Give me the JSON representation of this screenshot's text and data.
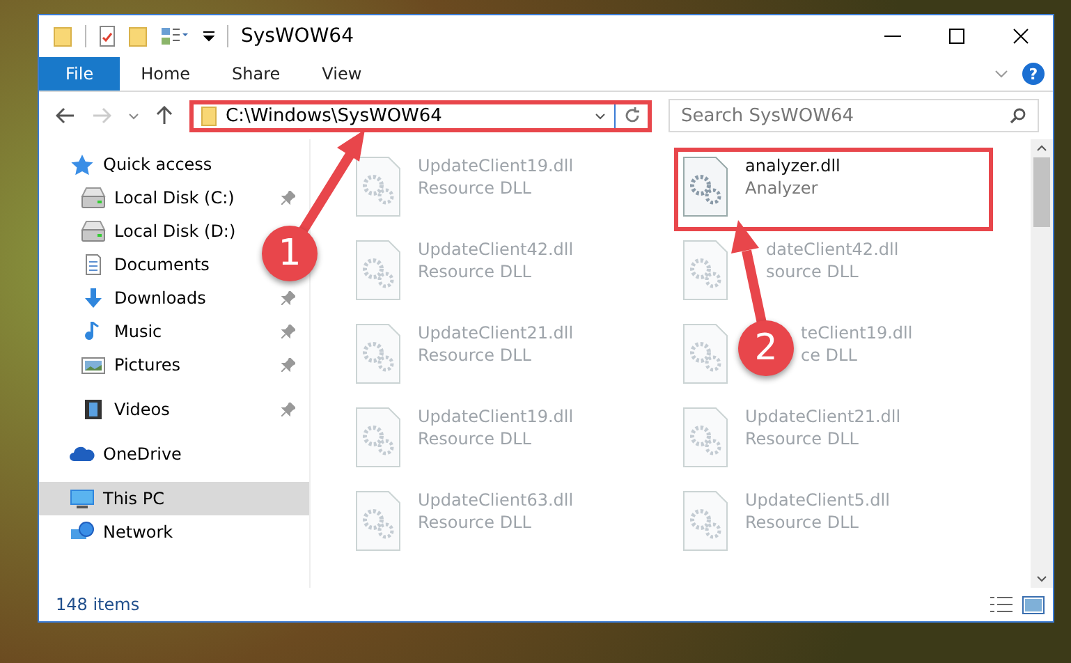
{
  "window": {
    "title": "SysWOW64"
  },
  "ribbon": {
    "tabs": [
      {
        "label": "File",
        "selected": true
      },
      {
        "label": "Home",
        "selected": false
      },
      {
        "label": "Share",
        "selected": false
      },
      {
        "label": "View",
        "selected": false
      }
    ],
    "help": "?"
  },
  "address_bar": {
    "path": "C:\\Windows\\SysWOW64",
    "highlighted": true
  },
  "search": {
    "placeholder": "Search SysWOW64"
  },
  "sidebar": {
    "items": [
      {
        "label": "Quick access",
        "kind": "star",
        "selected": false,
        "pinned": false,
        "children": [
          {
            "label": "Local Disk (C:)",
            "kind": "drive",
            "selected": false,
            "pinned": true
          },
          {
            "label": "Local Disk (D:)",
            "kind": "drive",
            "selected": false,
            "pinned": false
          },
          {
            "label": "Documents",
            "kind": "document",
            "selected": false,
            "pinned": false
          },
          {
            "label": "Downloads",
            "kind": "download",
            "selected": false,
            "pinned": true
          },
          {
            "label": "Music",
            "kind": "music",
            "selected": false,
            "pinned": true
          },
          {
            "label": "Pictures",
            "kind": "picture",
            "selected": false,
            "pinned": true
          },
          {
            "label": "Videos",
            "kind": "video",
            "selected": false,
            "pinned": true
          }
        ]
      },
      {
        "label": "OneDrive",
        "kind": "cloud",
        "selected": false,
        "pinned": false
      },
      {
        "label": "This PC",
        "kind": "computer",
        "selected": true,
        "pinned": false
      },
      {
        "label": "Network",
        "kind": "network",
        "selected": false,
        "pinned": false
      }
    ]
  },
  "files": [
    {
      "name": "UpdateClient19.dll",
      "type": "Resource DLL",
      "kind": "clear",
      "blurred": true,
      "highlighted": false
    },
    {
      "name": "analyzer.dll",
      "type": "Analyzer",
      "kind": "clear",
      "blurred": false,
      "highlighted": true
    },
    {
      "name": "UpdateClient42.dll",
      "type": "Resource DLL",
      "kind": "clear",
      "blurred": true,
      "highlighted": false
    },
    {
      "name": "dateClient42.dll",
      "type": "source DLL",
      "kind": "underarrow",
      "blurred": true,
      "highlighted": false
    },
    {
      "name": "UpdateClient21.dll",
      "type": "Resource DLL",
      "kind": "clear",
      "blurred": true,
      "highlighted": false
    },
    {
      "name": "teClient19.dll",
      "type": "ce DLL",
      "kind": "undercallout",
      "blurred": true,
      "highlighted": false
    },
    {
      "name": "UpdateClient19.dll",
      "type": "Resource DLL",
      "kind": "clear",
      "blurred": true,
      "highlighted": false
    },
    {
      "name": "UpdateClient21.dll",
      "type": "Resource DLL",
      "kind": "clear",
      "blurred": true,
      "highlighted": false
    },
    {
      "name": "UpdateClient63.dll",
      "type": "Resource DLL",
      "kind": "clear",
      "blurred": true,
      "highlighted": false
    },
    {
      "name": "UpdateClient5.dll",
      "type": "Resource DLL",
      "kind": "clear",
      "blurred": true,
      "highlighted": false
    }
  ],
  "status_bar": {
    "item_count": "148 items"
  },
  "callouts": [
    {
      "number": "1"
    },
    {
      "number": "2"
    }
  ]
}
